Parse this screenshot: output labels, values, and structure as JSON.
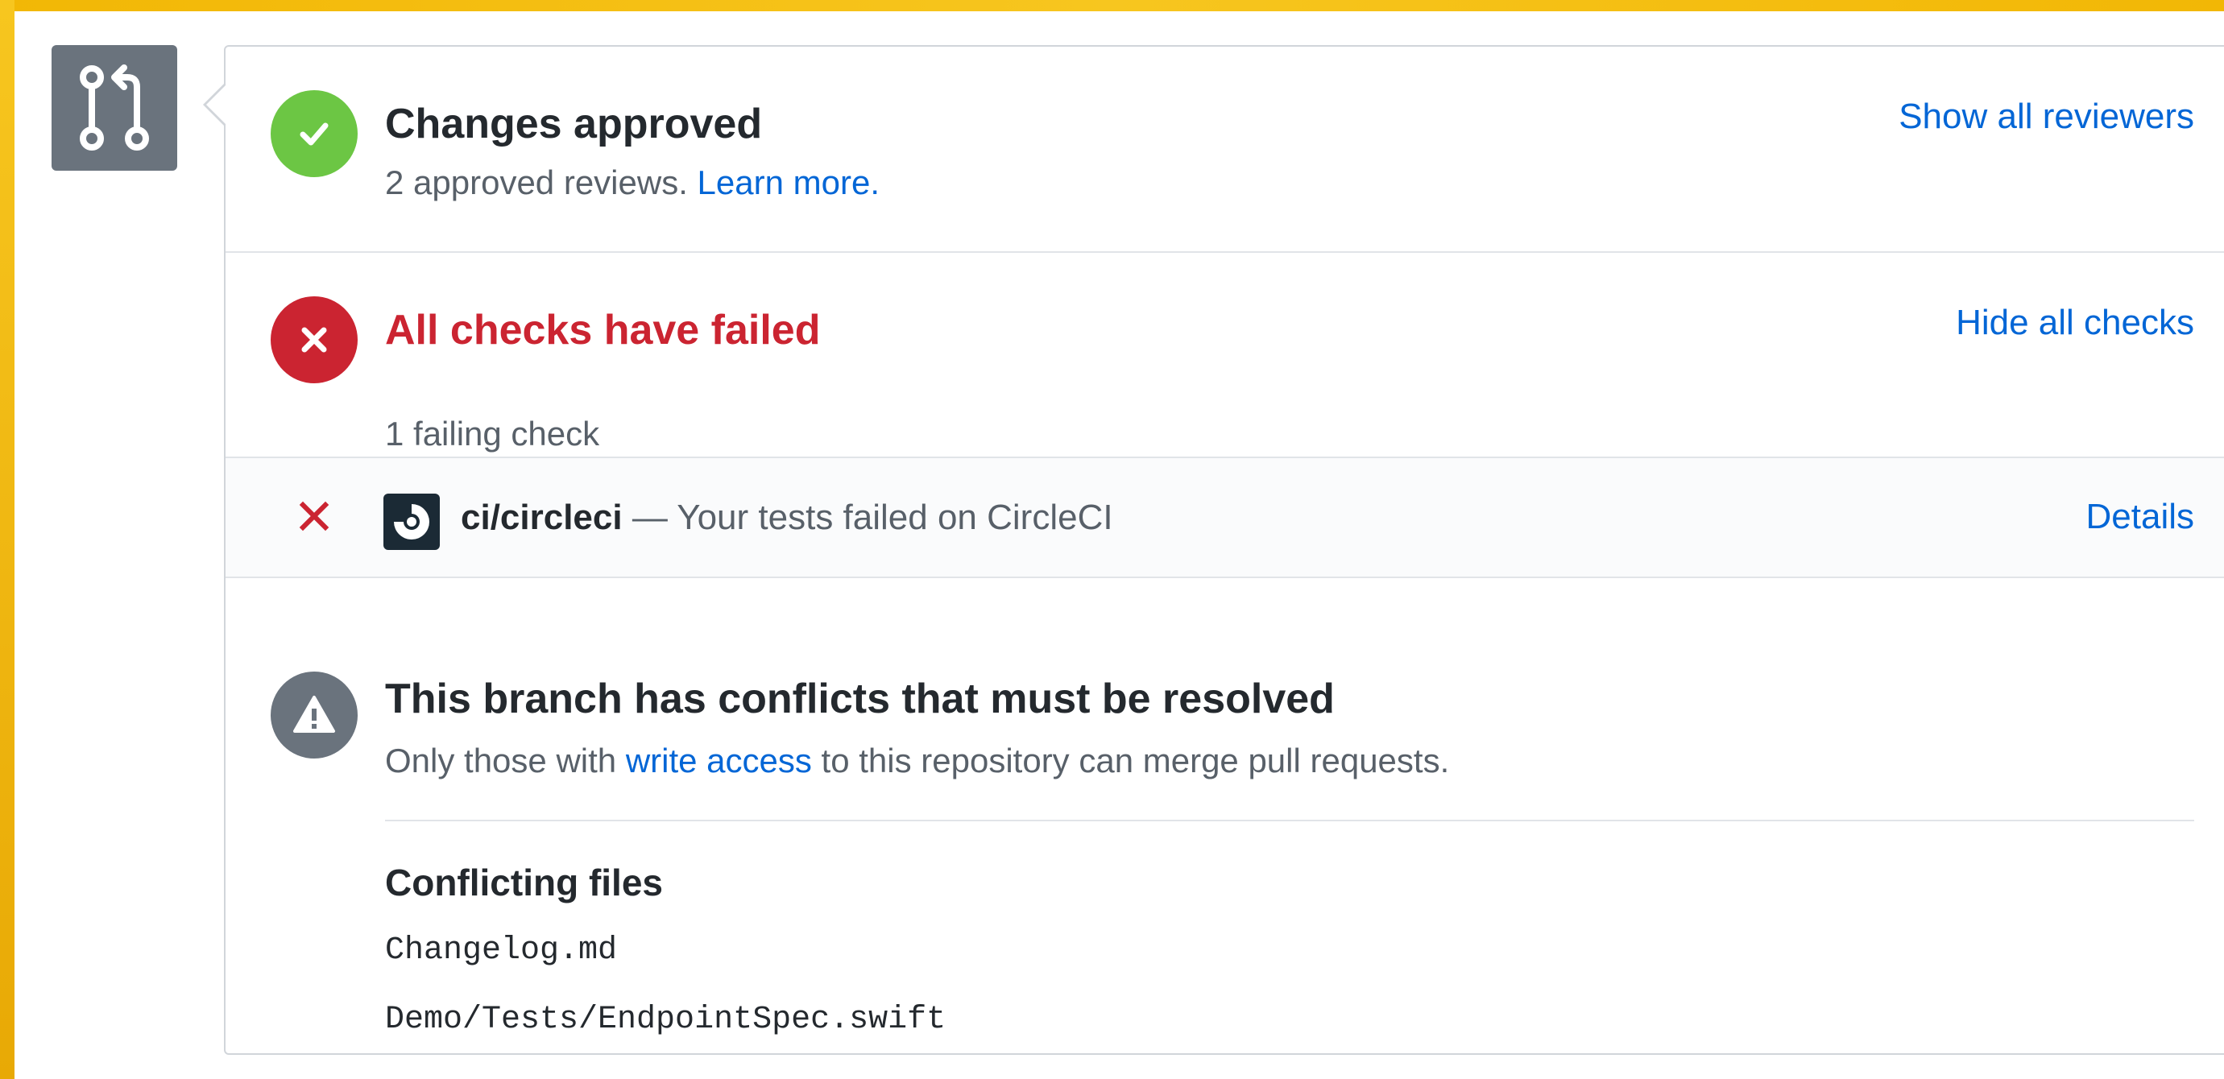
{
  "colors": {
    "frame": "#f7c61f",
    "approved": "#6cc644",
    "failed": "#cb2431",
    "neutral": "#6a737d",
    "link": "#0366d6"
  },
  "badge": {
    "icon": "git-pull-request-icon"
  },
  "review": {
    "icon": "check-icon",
    "title": "Changes approved",
    "subtitle": "2 approved reviews.",
    "learn_more": "Learn more.",
    "action": "Show all reviewers"
  },
  "checks": {
    "icon": "x-icon",
    "title": "All checks have failed",
    "subtitle": "1 failing check",
    "action": "Hide all checks",
    "items": [
      {
        "status_icon": "x-icon",
        "logo": "circleci-logo-icon",
        "name": "ci/circleci",
        "description": "— Your tests failed on CircleCI",
        "action": "Details"
      }
    ]
  },
  "conflicts": {
    "icon": "alert-icon",
    "title": "This branch has conflicts that must be resolved",
    "subtitle_before": "Only those with",
    "subtitle_link": "write access",
    "subtitle_after": "to this repository can merge pull requests.",
    "files_heading": "Conflicting files",
    "files": [
      "Changelog.md",
      "Demo/Tests/EndpointSpec.swift"
    ]
  }
}
